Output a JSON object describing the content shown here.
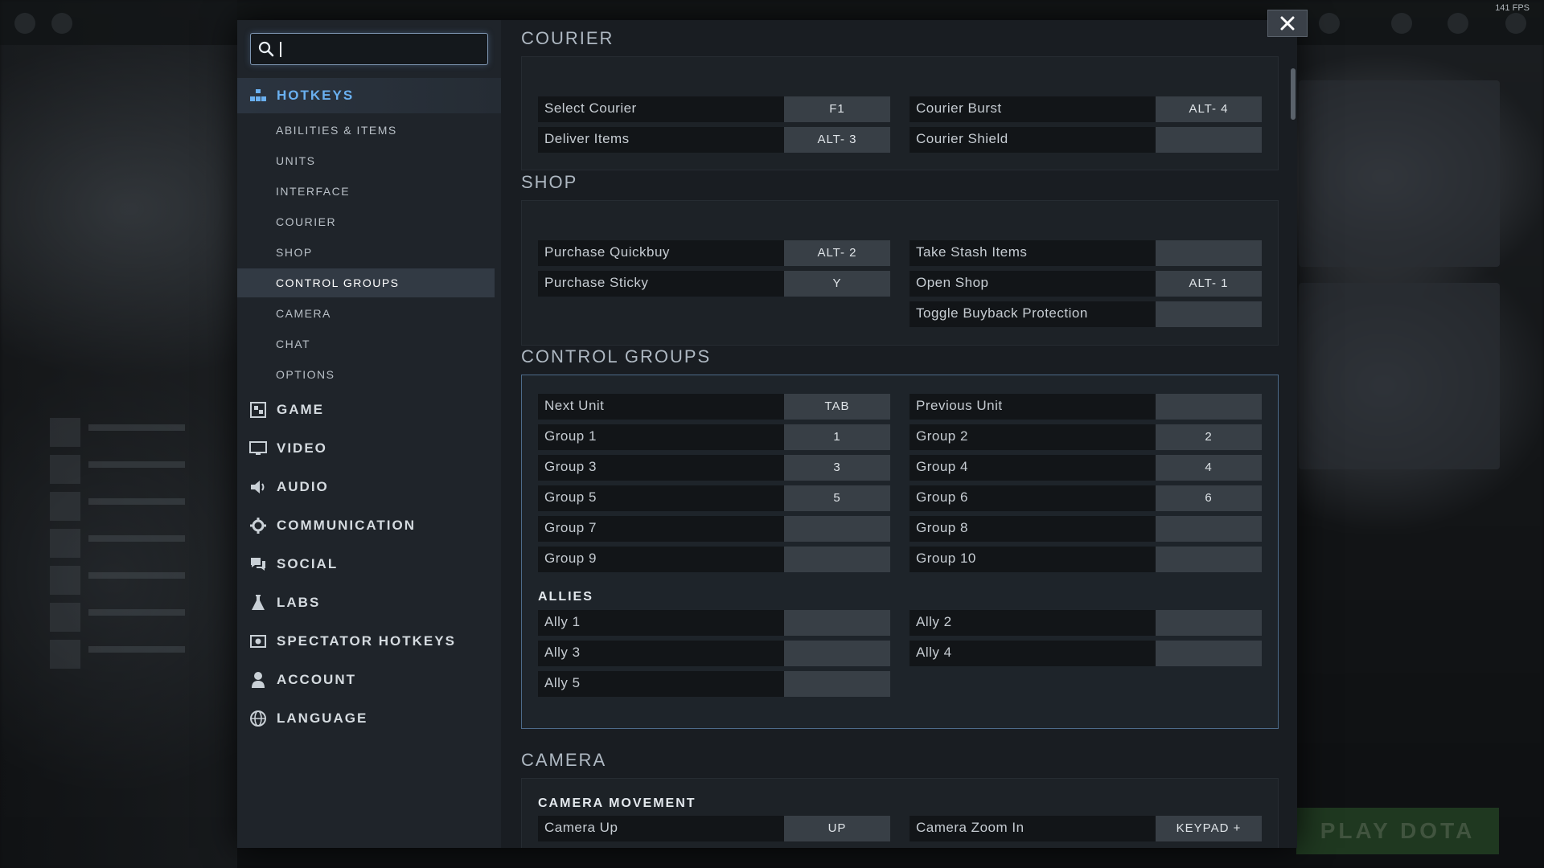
{
  "fps": "141 FPS",
  "background": {
    "play_label": "PLAY DOTA"
  },
  "search": {
    "value": "",
    "placeholder": ""
  },
  "sidebar": {
    "hotkeys": "HOTKEYS",
    "sub_items": [
      {
        "label": "ABILITIES & ITEMS",
        "active": false
      },
      {
        "label": "UNITS",
        "active": false
      },
      {
        "label": "INTERFACE",
        "active": false
      },
      {
        "label": "COURIER",
        "active": false
      },
      {
        "label": "SHOP",
        "active": false
      },
      {
        "label": "CONTROL GROUPS",
        "active": true
      },
      {
        "label": "CAMERA",
        "active": false
      },
      {
        "label": "CHAT",
        "active": false
      },
      {
        "label": "OPTIONS",
        "active": false
      }
    ],
    "main_items": [
      {
        "label": "GAME",
        "icon": "game-icon"
      },
      {
        "label": "VIDEO",
        "icon": "monitor-icon"
      },
      {
        "label": "AUDIO",
        "icon": "speaker-icon"
      },
      {
        "label": "COMMUNICATION",
        "icon": "gear-icon"
      },
      {
        "label": "SOCIAL",
        "icon": "chat-bubbles-icon"
      },
      {
        "label": "LABS",
        "icon": "flask-icon"
      },
      {
        "label": "SPECTATOR HOTKEYS",
        "icon": "spectator-icon"
      },
      {
        "label": "ACCOUNT",
        "icon": "person-icon"
      },
      {
        "label": "LANGUAGE",
        "icon": "globe-icon"
      }
    ]
  },
  "sections": {
    "courier": {
      "title": "COURIER",
      "left": [
        {
          "name": "Select Courier",
          "key": "F1"
        },
        {
          "name": "Deliver Items",
          "key": "ALT- 3"
        }
      ],
      "right": [
        {
          "name": "Courier Burst",
          "key": "ALT- 4"
        },
        {
          "name": "Courier Shield",
          "key": ""
        }
      ]
    },
    "shop": {
      "title": "SHOP",
      "left": [
        {
          "name": "Purchase Quickbuy",
          "key": "ALT- 2"
        },
        {
          "name": "Purchase Sticky",
          "key": "Y"
        }
      ],
      "right": [
        {
          "name": "Take Stash Items",
          "key": ""
        },
        {
          "name": "Open Shop",
          "key": "ALT- 1"
        },
        {
          "name": "Toggle Buyback Protection",
          "key": ""
        }
      ]
    },
    "control_groups": {
      "title": "CONTROL GROUPS",
      "left": [
        {
          "name": "Next Unit",
          "key": "TAB"
        },
        {
          "name": "Group 1",
          "key": "1"
        },
        {
          "name": "Group 3",
          "key": "3"
        },
        {
          "name": "Group 5",
          "key": "5"
        },
        {
          "name": "Group 7",
          "key": ""
        },
        {
          "name": "Group 9",
          "key": ""
        }
      ],
      "right": [
        {
          "name": "Previous Unit",
          "key": ""
        },
        {
          "name": "Group 2",
          "key": "2"
        },
        {
          "name": "Group 4",
          "key": "4"
        },
        {
          "name": "Group 6",
          "key": "6"
        },
        {
          "name": "Group 8",
          "key": ""
        },
        {
          "name": "Group 10",
          "key": ""
        }
      ],
      "allies_title": "ALLIES",
      "allies_left": [
        {
          "name": "Ally 1",
          "key": ""
        },
        {
          "name": "Ally 3",
          "key": ""
        },
        {
          "name": "Ally 5",
          "key": ""
        }
      ],
      "allies_right": [
        {
          "name": "Ally 2",
          "key": ""
        },
        {
          "name": "Ally 4",
          "key": ""
        }
      ]
    },
    "camera": {
      "title": "CAMERA",
      "movement_title": "CAMERA MOVEMENT",
      "left": [
        {
          "name": "Camera Up",
          "key": "UP"
        }
      ],
      "right": [
        {
          "name": "Camera Zoom In",
          "key": "KEYPAD +"
        }
      ]
    }
  },
  "colors": {
    "accent": "#6ab0f0",
    "highlight_border": "#4d6b8a"
  }
}
